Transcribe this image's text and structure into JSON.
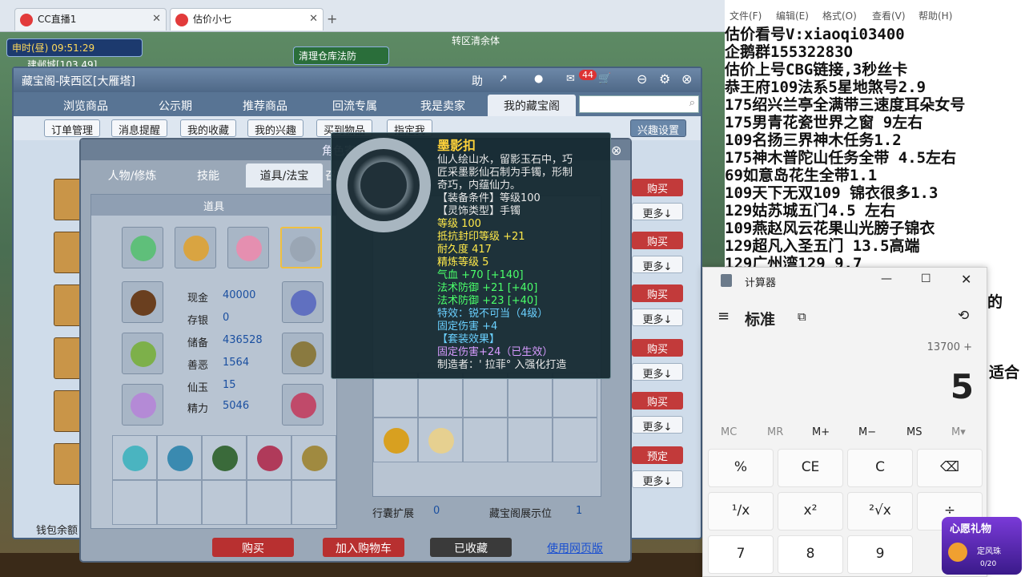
{
  "browser": {
    "tabs": [
      {
        "label": "CC直播1"
      },
      {
        "label": "估价小七"
      }
    ],
    "new_tab": "+"
  },
  "hud": {
    "time": "申时(昼)",
    "clock": "09:51:29",
    "location": "建邺城[103,49]",
    "banner": "清理仓库法防",
    "banner2": "转区清余体"
  },
  "window": {
    "title": "藏宝阁-陕西区[大雁塔]",
    "badge": "44",
    "nav": [
      "浏览商品",
      "公示期",
      "推荐商品",
      "回流专属",
      "我是卖家",
      "我的藏宝阁"
    ],
    "subnav": [
      "订单管理",
      "消息提醒",
      "我的收藏",
      "我的兴趣",
      "买到物品",
      "指定我"
    ],
    "interest_btn": "兴趣设置",
    "row_buttons": [
      "购买",
      "更多↓",
      "购买",
      "更多↓",
      "购买",
      "更多↓",
      "购买",
      "更多↓",
      "购买",
      "更多↓",
      "预定",
      "更多↓"
    ],
    "wallet": "钱包余额"
  },
  "role": {
    "title": "角色寄售信息",
    "tabs": [
      "人物/修炼",
      "技能",
      "道具/法宝",
      "召唤"
    ],
    "section": "道具",
    "stats": [
      {
        "label": "现金",
        "value": "40000"
      },
      {
        "label": "存银",
        "value": "0"
      },
      {
        "label": "储备",
        "value": "436528"
      },
      {
        "label": "善恶",
        "value": "1564"
      },
      {
        "label": "仙玉",
        "value": "15"
      },
      {
        "label": "精力",
        "value": "5046"
      }
    ],
    "bag_expand_label": "行囊扩展",
    "bag_expand_value": "0",
    "display_label": "藏宝阁展示位",
    "display_value": "1",
    "buttons": {
      "buy": "购买",
      "cart": "加入购物车",
      "fav": "已收藏",
      "web": "使用网页版"
    }
  },
  "tooltip": {
    "name": "墨影扣",
    "lines": [
      {
        "t": "仙人绘山水，留影玉石中，巧",
        "c": "w"
      },
      {
        "t": "匠采墨影仙石制为手镯，形制",
        "c": "w"
      },
      {
        "t": "奇巧，内蕴仙力。",
        "c": "w"
      },
      {
        "t": "【装备条件】等级100",
        "c": "w"
      },
      {
        "t": "【灵饰类型】手镯",
        "c": "w"
      },
      {
        "t": "等级 100",
        "c": "y"
      },
      {
        "t": "抵抗封印等级 +21",
        "c": "y"
      },
      {
        "t": "耐久度 417",
        "c": "y"
      },
      {
        "t": "精炼等级 5",
        "c": "y"
      },
      {
        "t": "气血 +70 [+140]",
        "c": "g"
      },
      {
        "t": "法术防御 +21 [+40]",
        "c": "g"
      },
      {
        "t": "法术防御 +23 [+40]",
        "c": "g"
      },
      {
        "t": "特效：锐不可当（4级）",
        "c": "b"
      },
      {
        "t": "固定伤害 +4",
        "c": "b"
      },
      {
        "t": "【套装效果】",
        "c": "b"
      },
      {
        "t": "固定伤害+24（已生效）",
        "c": "p"
      },
      {
        "t": "制造者：' 拉菲° 入强化打造",
        "c": "w"
      }
    ]
  },
  "notepad": {
    "menu": [
      "文件(F)",
      "编辑(E)",
      "格式(O)",
      "查看(V)",
      "帮助(H)"
    ],
    "lines": [
      "估价看号V:xiaoqi03400",
      "企鹅群15532283O",
      "估价上号CBG链接,3秒丝卡",
      "恭王府109法系5星地煞号2.9",
      "175绍兴兰亭全满带三速度耳朵女号",
      "175男青花瓷世界之窗  9左右",
      "109名扬三界神木任务1.2",
      "175神木普陀山任务全带 4.5左右",
      "69如意岛花生全带1.1",
      "109天下无双109  锦衣很多1.3",
      "129姑苏城五门4.5 左右",
      "109燕赵风云花果山光膀子锦衣",
      "129超凡入圣五门  13.5高端",
      "129广州湾129 9.7"
    ],
    "extra": [
      "的",
      "适合"
    ]
  },
  "calculator": {
    "title": "计算器",
    "mode": "标准",
    "expression": "13700 +",
    "display": "5",
    "memory": [
      "MC",
      "MR",
      "M+",
      "M−",
      "MS",
      "M▾"
    ],
    "keys": [
      "%",
      "CE",
      "C",
      "⌫",
      "¹∕x",
      "x²",
      "²√x",
      "÷",
      "7",
      "8",
      "9"
    ]
  },
  "gift": {
    "title": "心愿礼物",
    "item": "定风珠",
    "progress": "0/20"
  },
  "colors": {
    "accent": "#c23a3a",
    "nav": "#587494"
  }
}
